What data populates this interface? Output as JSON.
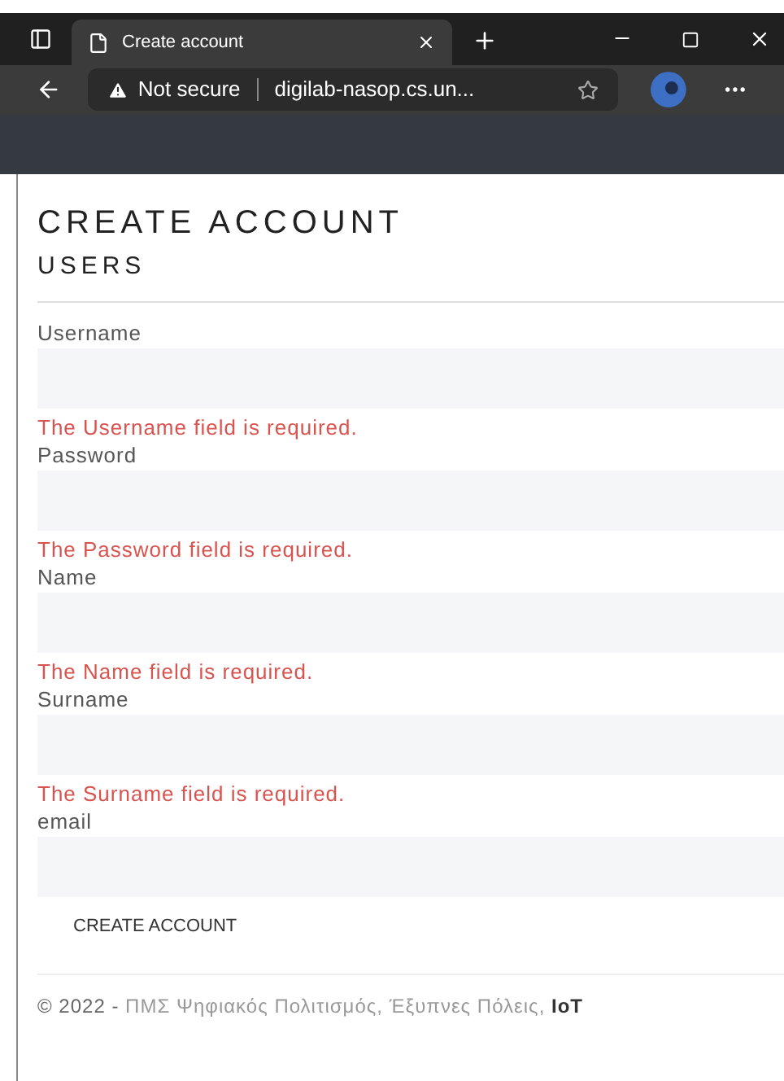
{
  "browser": {
    "tab_title": "Create account",
    "security": "Not secure",
    "address": "digilab-nasop.cs.un..."
  },
  "page": {
    "title": "CREATE ACCOUNT",
    "subtitle": "USERS"
  },
  "fields": [
    {
      "label": "Username",
      "error": "The Username field is required."
    },
    {
      "label": "Password",
      "error": "The Password field is required."
    },
    {
      "label": "Name",
      "error": "The Name field is required."
    },
    {
      "label": "Surname",
      "error": "The Surname field is required."
    },
    {
      "label": "email"
    }
  ],
  "submit": "CREATE ACCOUNT",
  "footer": {
    "copyright": "© 2022 -",
    "link": "ΠΜΣ Ψηφιακός Πολιτισμός, Έξυπνες Πόλεις,",
    "suffix": "IoT"
  }
}
